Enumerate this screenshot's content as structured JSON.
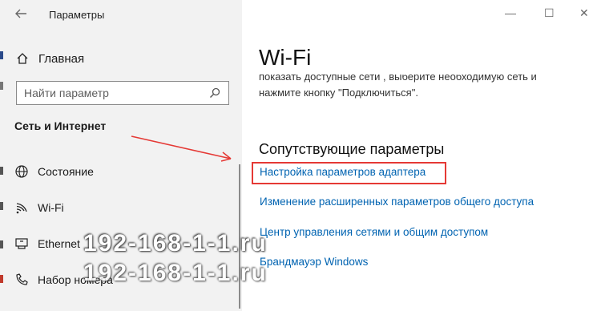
{
  "window": {
    "title": "Параметры",
    "minimize": "—",
    "maximize": "☐",
    "close": "✕"
  },
  "sidebar": {
    "home_label": "Главная",
    "search_placeholder": "Найти параметр",
    "category": "Сеть и Интернет",
    "items": [
      {
        "label": "Состояние",
        "icon": "globe-icon"
      },
      {
        "label": "Wi-Fi",
        "icon": "wifi-icon"
      },
      {
        "label": "Ethernet",
        "icon": "ethernet-icon"
      },
      {
        "label": "Набор номера",
        "icon": "phone-icon"
      }
    ]
  },
  "main": {
    "title": "Wi-Fi",
    "description_line1": "показать доступные сети , выберите необходимую сеть и",
    "description_line2": "нажмите кнопку \"Подключиться\".",
    "section_title": "Сопутствующие параметры",
    "links": [
      "Настройка параметров адаптера",
      "Изменение расширенных параметров общего доступа",
      "Центр управления сетями и общим доступом",
      "Брандмауэр Windows"
    ]
  },
  "watermark": {
    "text1": "192-168-1-1.ru",
    "text2": "192-168-1-1.ru"
  },
  "colors": {
    "link": "#0063b1",
    "highlight": "#e53935",
    "sidebar_bg": "#f2f2f2"
  }
}
